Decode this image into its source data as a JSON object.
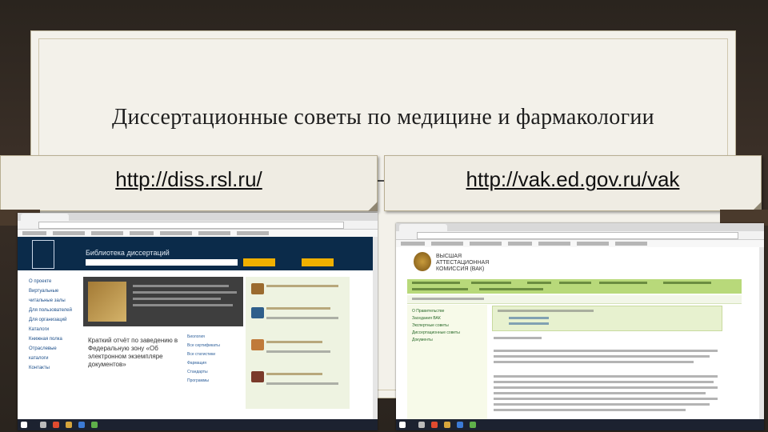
{
  "slide": {
    "title": "Диссертационные советы по медицине и фармакологии"
  },
  "links": {
    "left_url": "http://diss.rsl.ru/",
    "right_url": "http://vak.ed.gov.ru/vak"
  },
  "left_screenshot": {
    "site_title": "Библиотека диссертаций",
    "sidebar": [
      "О проекте",
      "Виртуальные читальные залы",
      "Для пользователей",
      "Для организаций",
      "Каталоги",
      "Книжная полка",
      "Отраслевые каталоги",
      "Контакты"
    ],
    "featured_text": "Краткий отчёт по заведению в Федеральную зону «Об электронном экземпляре документов»",
    "category_links": [
      "Биология",
      "Все сертификаты",
      "Все статистики",
      "Фармация",
      "Стандарты",
      "Программы"
    ]
  },
  "right_screenshot": {
    "brand": "ВЫСШАЯ АТТЕСТАЦИОННАЯ КОМИССИЯ (ВАК)",
    "sidebar": [
      "О Правительстве",
      "Заседания ВАК",
      "Экспертные советы",
      "Диссертационные советы",
      "Документы"
    ]
  },
  "colors": {
    "rsl_header": "#0b2b4a",
    "vak_nav": "#b8d97a",
    "slide_bg": "#f3f1ea"
  }
}
